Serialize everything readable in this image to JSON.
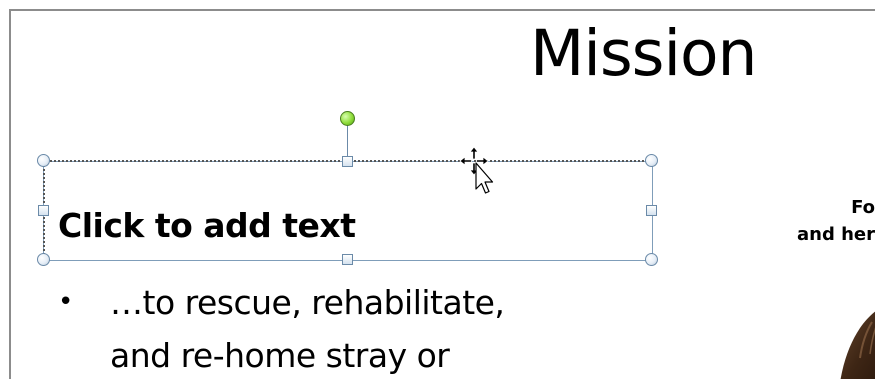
{
  "slide": {
    "title": "Mission",
    "textbox_placeholder": "Click to add text",
    "bullets": [
      "…to rescue, rehabilitate,",
      "and re-home stray or"
    ],
    "caption_lines": [
      "Fo",
      "and her"
    ]
  },
  "icons": {
    "cursor": "move-cursor-icon",
    "rotate": "rotate-handle-icon"
  },
  "colors": {
    "handle_border": "#6b8aa8",
    "rotate_handle": "#8fdc3a",
    "frame": "#8c8c8c"
  }
}
